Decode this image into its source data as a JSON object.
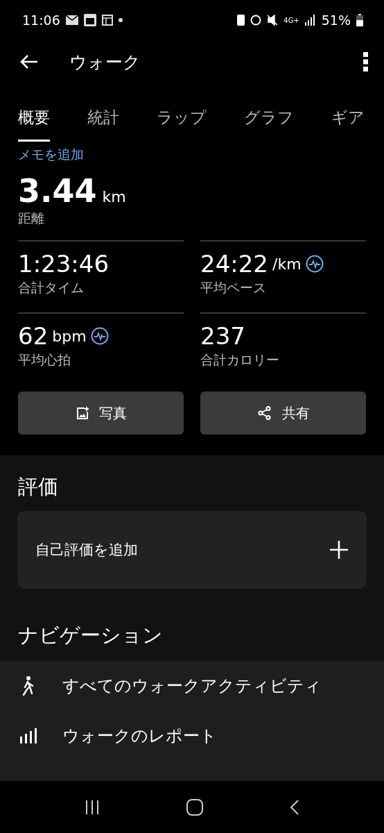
{
  "status_bar": {
    "time": "11:06",
    "battery": "51%",
    "network": "4G+"
  },
  "app_bar": {
    "title": "ウォーク"
  },
  "tabs": [
    {
      "label": "概要",
      "selected": true
    },
    {
      "label": "統計",
      "selected": false
    },
    {
      "label": "ラップ",
      "selected": false
    },
    {
      "label": "グラフ",
      "selected": false
    },
    {
      "label": "ギア",
      "selected": false
    }
  ],
  "memo_link": "メモを追加",
  "distance": {
    "value": "3.44",
    "unit": "km",
    "label": "距離"
  },
  "stats": [
    {
      "value": "1:23:46",
      "label": "合計タイム",
      "chart_link": false
    },
    {
      "value": "24:22",
      "unit": "/km",
      "label": "平均ペース",
      "chart_link": true
    },
    {
      "value": "62",
      "unit": "bpm",
      "label": "平均心拍",
      "chart_link": true
    },
    {
      "value": "237",
      "label": "合計カロリー",
      "chart_link": false
    }
  ],
  "buttons": [
    {
      "kind": "photo",
      "label": "写真"
    },
    {
      "kind": "share",
      "label": "共有"
    }
  ],
  "rating": {
    "title": "評価",
    "add_label": "自己評価を追加"
  },
  "navigation": {
    "title": "ナビゲーション",
    "items": [
      {
        "kind": "walk",
        "label": "すべてのウォークアクティビティ"
      },
      {
        "kind": "report",
        "label": "ウォークのレポート"
      }
    ]
  }
}
